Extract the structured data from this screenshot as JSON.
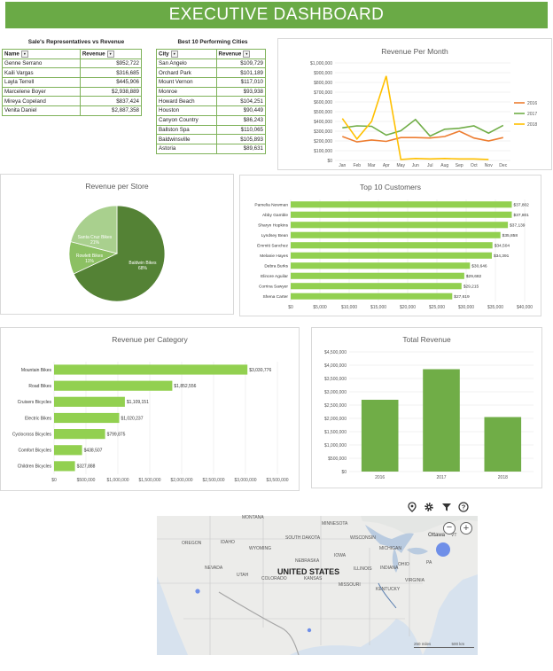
{
  "header": {
    "title": "EXECUTIVE DASHBOARD"
  },
  "reps_table": {
    "title": "Sale's Representatives vs Revenue",
    "columns": [
      "Name",
      "Revenue"
    ],
    "rows": [
      [
        "Genne Serrano",
        "$952,722"
      ],
      [
        "Kaili Vargas",
        "$316,685"
      ],
      [
        "Layla Terrell",
        "$445,906"
      ],
      [
        "Marcelene Boyer",
        "$2,938,889"
      ],
      [
        "Mireya Copeland",
        "$837,424"
      ],
      [
        "Venita Daniel",
        "$2,887,358"
      ]
    ]
  },
  "cities_table": {
    "title": "Best 10 Performing Cities",
    "columns": [
      "City",
      "Revenue"
    ],
    "rows": [
      [
        "San Angelo",
        "$109,729"
      ],
      [
        "Orchard Park",
        "$101,189"
      ],
      [
        "Mount Vernon",
        "$117,010"
      ],
      [
        "Monroe",
        "$93,938"
      ],
      [
        "Howard Beach",
        "$104,251"
      ],
      [
        "Houston",
        "$90,449"
      ],
      [
        "Canyon Country",
        "$86,243"
      ],
      [
        "Ballston Spa",
        "$110,065"
      ],
      [
        "Baldwinsville",
        "$105,893"
      ],
      [
        "Astoria",
        "$89,631"
      ]
    ]
  },
  "map": {
    "country_label": "UNITED STATES",
    "labels": [
      "MONTANA",
      "MINNESOTA",
      "OREGON",
      "IDAHO",
      "WYOMING",
      "SOUTH DAKOTA",
      "WISCONSIN",
      "MICHIGAN",
      "NEBRASKA",
      "IOWA",
      "NEVADA",
      "UTAH",
      "COLORADO",
      "KANSAS",
      "ILLINOIS",
      "INDIANA",
      "OHIO",
      "PA",
      "MISSOURI",
      "KENTUCKY",
      "VIRGINIA",
      "Ottawa",
      "VT"
    ],
    "scale_labels": [
      "250 miles",
      "500 km"
    ],
    "tool_icons": [
      "location-pin-icon",
      "gear-icon",
      "filter-icon",
      "help-icon"
    ],
    "zoom_out": "−",
    "zoom_in": "+"
  },
  "chart_data": [
    {
      "type": "line",
      "title": "Revenue Per Month",
      "categories": [
        "Jan",
        "Feb",
        "Mar",
        "Apr",
        "May",
        "Jun",
        "Jul",
        "Aug",
        "Sep",
        "Oct",
        "Nov",
        "Dec"
      ],
      "ylim": [
        0,
        1000000
      ],
      "yticks": [
        "$0",
        "$100,000",
        "$200,000",
        "$300,000",
        "$400,000",
        "$500,000",
        "$600,000",
        "$700,000",
        "$800,000",
        "$900,000",
        "$1,000,000"
      ],
      "legend_position": "right",
      "series": [
        {
          "name": "2016",
          "color": "#ed7d31",
          "values": [
            245000,
            190000,
            210000,
            195000,
            235000,
            235000,
            230000,
            245000,
            300000,
            230000,
            200000,
            235000
          ]
        },
        {
          "name": "2017",
          "color": "#70ad47",
          "values": [
            335000,
            355000,
            350000,
            260000,
            305000,
            420000,
            250000,
            320000,
            330000,
            355000,
            280000,
            360000
          ]
        },
        {
          "name": "2018",
          "color": "#ffc000",
          "values": [
            430000,
            220000,
            400000,
            865000,
            10000,
            20000,
            15000,
            20000,
            15000,
            15000,
            10000,
            null
          ]
        }
      ]
    },
    {
      "type": "pie",
      "title": "Revenue per Store",
      "slices": [
        {
          "label": "Baldwin Bikes",
          "pct": "68%",
          "value": 68,
          "color": "#548235"
        },
        {
          "label": "Rowlett Bikes",
          "pct": "11%",
          "value": 11,
          "color": "#8cc063"
        },
        {
          "label": "Santa Cruz Bikes",
          "pct": "21%",
          "value": 21,
          "color": "#a9d08e"
        }
      ]
    },
    {
      "type": "bar",
      "title": "Top 10 Customers",
      "orientation": "horizontal",
      "color": "#92d050",
      "categories": [
        "Pamelia Newman",
        "Abby Gamble",
        "Sharyn Hopkins",
        "Lyndsey Bean",
        "Emmitt Sanchez",
        "Melanie Hayes",
        "Debra Burks",
        "Elinore Aguilar",
        "Corrina Sawyer",
        "Shena Carter"
      ],
      "values": [
        37802,
        37801,
        37139,
        35858,
        34504,
        34391,
        30646,
        29682,
        29215,
        27619
      ],
      "value_labels": [
        "$37,802",
        "$37,801",
        "$37,139",
        "$35,858",
        "$34,504",
        "$34,391",
        "$30,646",
        "$29,682",
        "$29,215",
        "$27,619"
      ],
      "xlim": [
        0,
        40000
      ],
      "xticks": [
        "$0",
        "$5,000",
        "$10,000",
        "$15,000",
        "$20,000",
        "$25,000",
        "$30,000",
        "$35,000",
        "$40,000"
      ]
    },
    {
      "type": "bar",
      "title": "Revenue per Category",
      "orientation": "horizontal",
      "color": "#92d050",
      "categories": [
        "Mountain Bikes",
        "Road Bikes",
        "Cruisers Bicycles",
        "Electric Bikes",
        "Cyclocross Bicycles",
        "Comfort Bicycles",
        "Children Bicycles"
      ],
      "values": [
        3030776,
        1852556,
        1109151,
        1020237,
        799875,
        438507,
        327888
      ],
      "value_labels": [
        "$3,030,776",
        "$1,852,556",
        "$1,109,151",
        "$1,020,237",
        "$799,875",
        "$438,507",
        "$327,888"
      ],
      "xlim": [
        0,
        3500000
      ],
      "xticks": [
        "$0",
        "$500,000",
        "$1,000,000",
        "$1,500,000",
        "$2,000,000",
        "$2,500,000",
        "$3,000,000",
        "$3,500,000"
      ]
    },
    {
      "type": "bar",
      "title": "Total Revenue",
      "orientation": "vertical",
      "color": "#70ad47",
      "categories": [
        "2016",
        "2017",
        "2018"
      ],
      "values": [
        2700000,
        3850000,
        2050000
      ],
      "ylim": [
        0,
        4500000
      ],
      "yticks": [
        "$0",
        "$500,000",
        "$1,000,000",
        "$1,500,000",
        "$2,000,000",
        "$2,500,000",
        "$3,000,000",
        "$3,500,000",
        "$4,000,000",
        "$4,500,000"
      ]
    }
  ]
}
